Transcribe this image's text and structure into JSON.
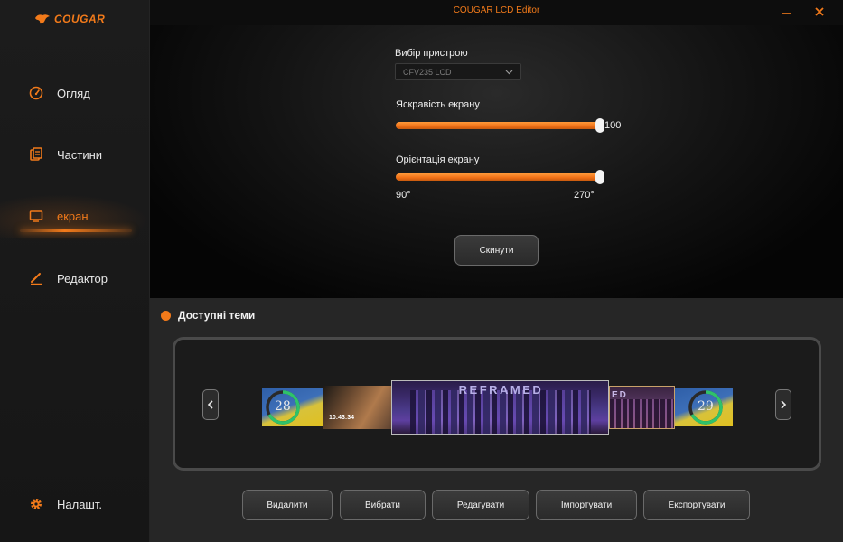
{
  "app": {
    "brand": "COUGAR",
    "title": "COUGAR LCD Editor"
  },
  "window": {
    "minimize_icon": "minimize-icon",
    "close_icon": "close-icon"
  },
  "sidebar": {
    "items": [
      {
        "label": "Огляд",
        "icon": "speedometer-icon",
        "active": false
      },
      {
        "label": "Частини",
        "icon": "parts-icon",
        "active": false
      },
      {
        "label": "екран",
        "icon": "monitor-icon",
        "active": true
      },
      {
        "label": "Редактор",
        "icon": "pen-icon",
        "active": false
      }
    ],
    "settings": {
      "label": "Налашт.",
      "icon": "gear-icon"
    }
  },
  "device": {
    "label": "Вибір пристрою",
    "selected": "CFV235 LCD"
  },
  "brightness": {
    "label": "Яскравість екрану",
    "value": 100,
    "max": 100,
    "value_text": "100"
  },
  "orientation": {
    "label": "Орієнтація екрану",
    "value": 270,
    "min": 90,
    "max": 270,
    "min_text": "90°",
    "max_text": "270°"
  },
  "reset_button": "Скинути",
  "themes": {
    "title": "Доступні теми",
    "items": [
      {
        "number": "28"
      },
      {
        "time": "10:43:34"
      },
      {
        "title": "REFRAMED"
      },
      {
        "title": "ED"
      },
      {
        "number": "29"
      }
    ],
    "buttons": [
      "Видалити",
      "Вибрати",
      "Редагувати",
      "Імпортувати",
      "Експортувати"
    ]
  },
  "colors": {
    "accent": "#f27a1a",
    "panel": "#262626",
    "sidebar": "#1a1a1a"
  }
}
